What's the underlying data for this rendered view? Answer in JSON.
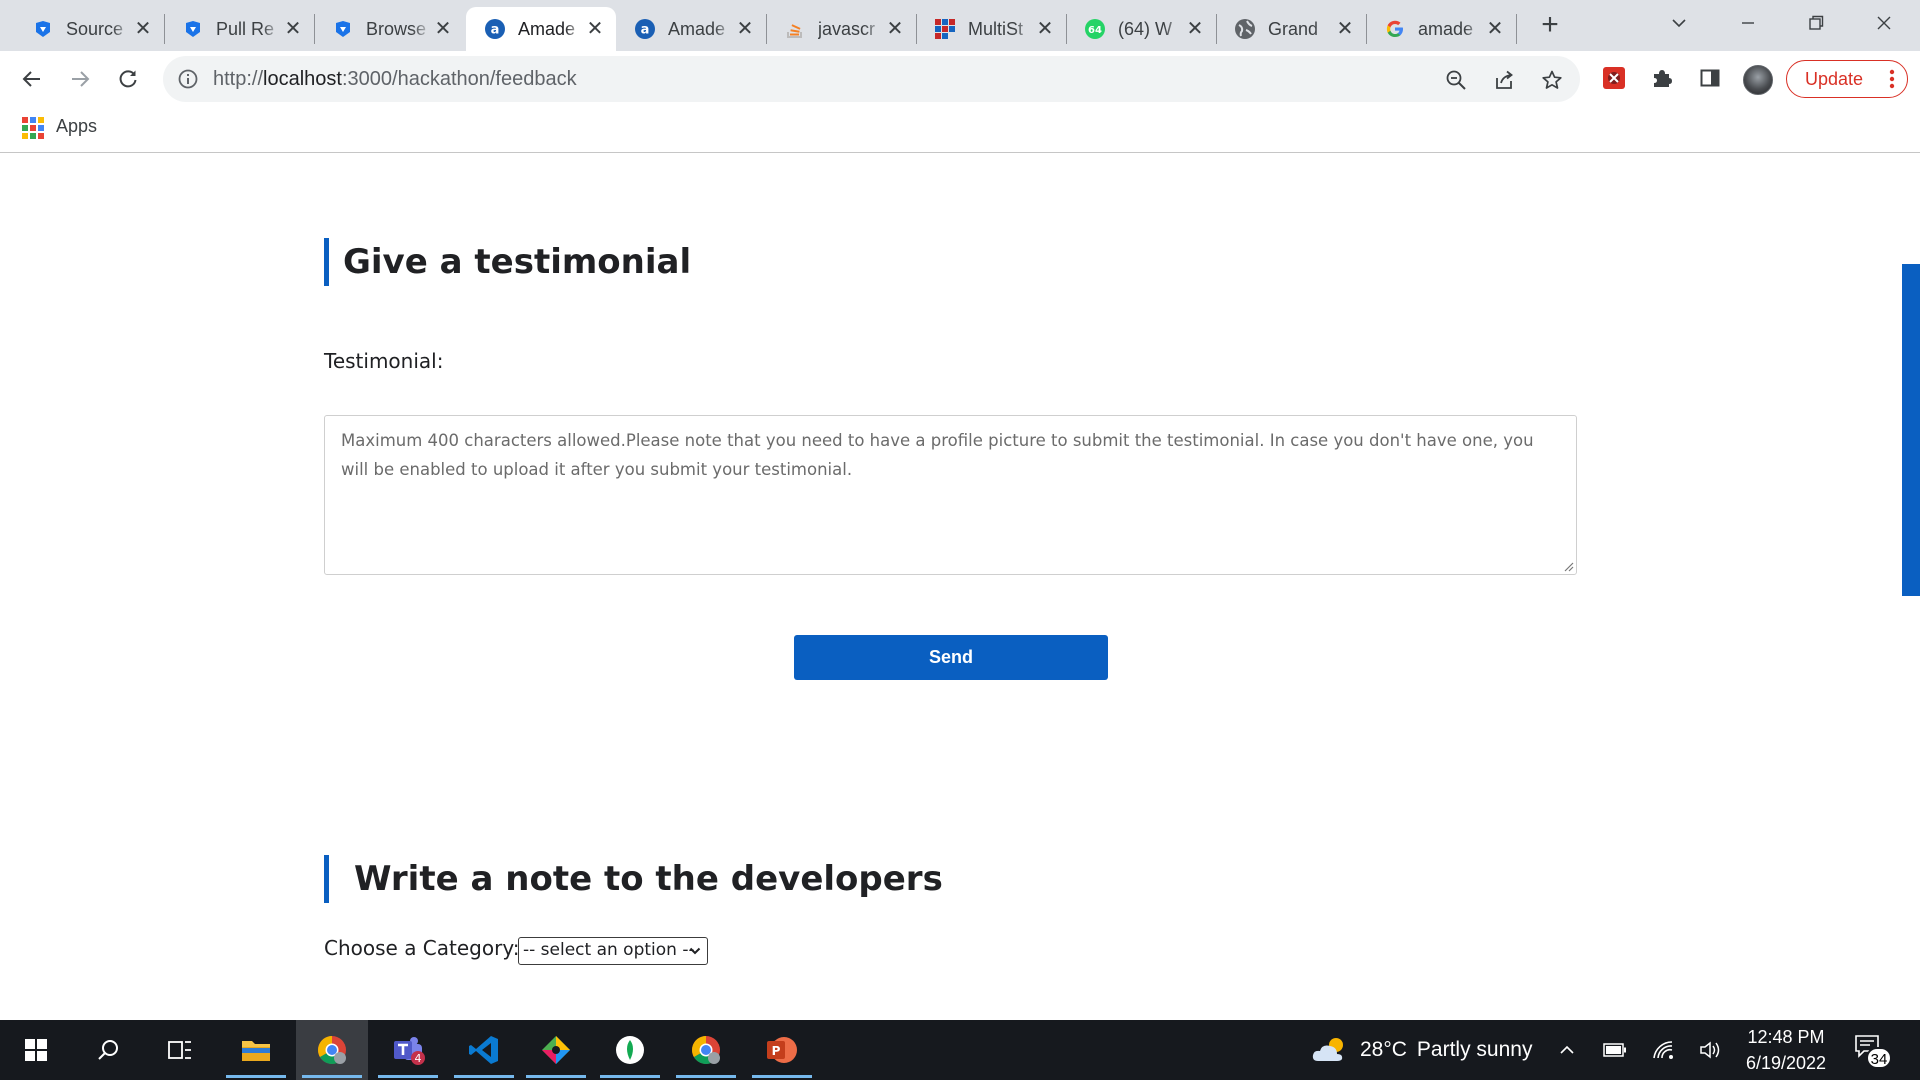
{
  "browser": {
    "tabs": [
      {
        "title": "Source",
        "icon": "azure-devops-icon"
      },
      {
        "title": "Pull Re",
        "icon": "azure-devops-icon"
      },
      {
        "title": "Browse",
        "icon": "azure-devops-icon"
      },
      {
        "title": "Amade",
        "icon": "amadeus-icon",
        "active": true
      },
      {
        "title": "Amade",
        "icon": "amadeus-icon"
      },
      {
        "title": "javascr",
        "icon": "stackoverflow-icon"
      },
      {
        "title": "MultiSt",
        "icon": "multistore-icon"
      },
      {
        "title": "(64) W",
        "icon": "whatsapp-icon"
      },
      {
        "title": "Grand",
        "icon": "globe-icon"
      },
      {
        "title": "amade",
        "icon": "google-icon"
      }
    ],
    "address": {
      "prefix": "http://",
      "host": "localhost",
      "rest": ":3000/hackathon/feedback"
    },
    "update_label": "Update",
    "bookmarks": {
      "apps_label": "Apps"
    }
  },
  "page": {
    "testimonial": {
      "heading": "Give a testimonial",
      "label": "Testimonial:",
      "placeholder": "Maximum 400 characters allowed.Please note that you need to have a profile picture to submit the testimonial. In case you don't have one, you will be enabled to upload it after you submit your testimonial.",
      "send_label": "Send"
    },
    "developers_note": {
      "heading": "Write a note to the developers",
      "category_label": "Choose a Category:",
      "category_selected": "-- select an option --"
    }
  },
  "taskbar": {
    "weather": {
      "temperature": "28°C",
      "condition": "Partly sunny"
    },
    "clock": {
      "time": "12:48 PM",
      "date": "6/19/2022"
    },
    "notifications_count": "34",
    "teams_badge": "4"
  },
  "colors": {
    "accent": "#0a5fc1",
    "update_red": "#d93025",
    "taskbar": "#16191e"
  }
}
